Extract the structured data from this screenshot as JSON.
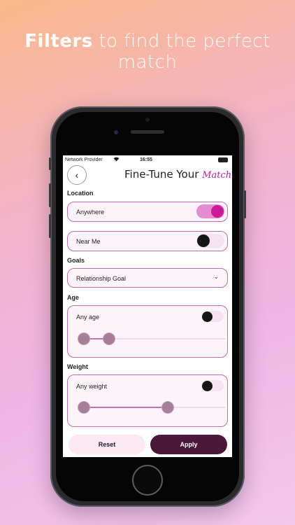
{
  "headline": {
    "bold": "Filters",
    "rest": " to find the perfect match"
  },
  "status_bar": {
    "carrier": "Network Provider",
    "wifi_icon": "wifi-icon",
    "time": "16:55",
    "battery_icon": "battery-icon"
  },
  "header": {
    "back_icon": "‹",
    "title": "Fine-Tune Your ",
    "title_accent": "Match"
  },
  "location": {
    "label": "Location",
    "anywhere": {
      "label": "Anywhere",
      "enabled": true
    },
    "near_me": {
      "label": "Near Me",
      "enabled": false
    }
  },
  "goals": {
    "label": "Goals",
    "select_value": "Relationship Goal",
    "chevron": "⌄"
  },
  "age": {
    "label": "Age",
    "toggle_label": "Any age",
    "enabled": false,
    "range_low_fraction": 0.0,
    "range_high_fraction": 0.18
  },
  "weight": {
    "label": "Weight",
    "toggle_label": "Any weight",
    "enabled": false,
    "range_low_fraction": 0.0,
    "range_high_fraction": 0.6
  },
  "actions": {
    "reset": "Reset",
    "apply": "Apply"
  },
  "colors": {
    "accent": "#cc1a9a",
    "apply_bg": "#4a1838",
    "card_border": "#c06ab0"
  }
}
